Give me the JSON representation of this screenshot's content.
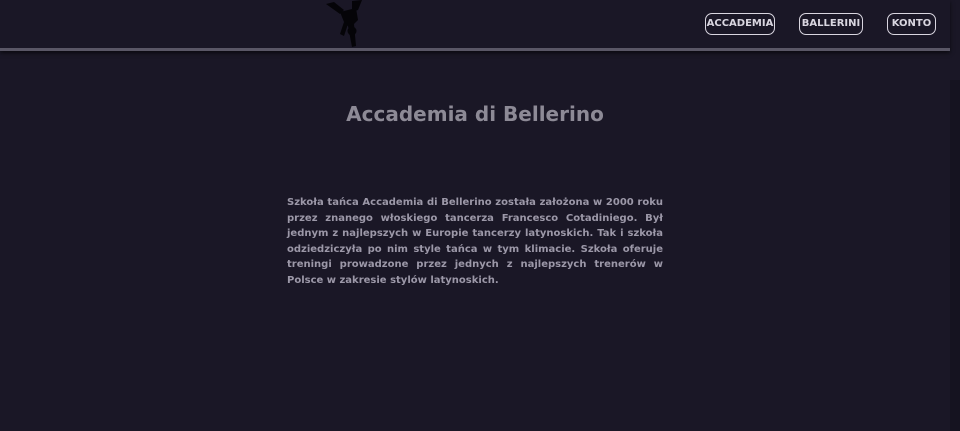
{
  "navbar": {
    "logo_icon": "breakdancer-silhouette-icon",
    "buttons": [
      "ACCADEMIA",
      "BALLERINI",
      "KONTO"
    ]
  },
  "main": {
    "title": "Accademia di Bellerino",
    "description": "Szkoła tańca Accademia di Bellerino została założona w 2000 roku przez znanego włoskiego tancerza Francesco Cotadiniego. Był jednym z najlepszych w Europie tancerzy latynoskich. Tak i szkoła odziedziczyła po nim style tańca w tym klimacie. Szkoła oferuje treningi prowadzone przez jednych z najlepszych trenerów w Polsce w zakresie stylów latynoskich."
  },
  "colors": {
    "background": "#1a1726",
    "accent": "#d9d6e0"
  }
}
